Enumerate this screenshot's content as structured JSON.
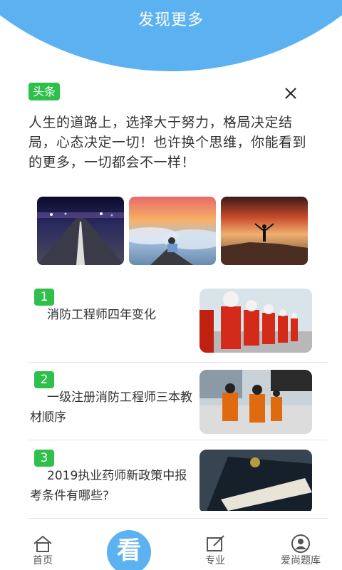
{
  "header": {
    "title": "发现更多"
  },
  "headline_card": {
    "tag": "头条",
    "text": "人生的道路上，选择大于努力，格局决定结局，心态决定一切！也许换个思维，你能看到的更多，一切都会不一样！",
    "images": [
      "night-road-photo",
      "sea-of-clouds-photo",
      "mountain-sunset-photo"
    ]
  },
  "articles": [
    {
      "num": "1",
      "title": "消防工程师四年变化",
      "image": "firefighters-parade-photo"
    },
    {
      "num": "2",
      "title": "一级注册消防工程师三本教材顺序",
      "image": "firefighters-training-photo"
    },
    {
      "num": "3",
      "title": "2019执业药师新政策中报考条件有哪些?",
      "image": "pharmacist-certificate-photo"
    }
  ],
  "bottom_nav": {
    "home": "首页",
    "center": "看",
    "major": "专业",
    "question_bank": "爱尚题库"
  },
  "colors": {
    "accent": "#5cb2f0",
    "tag_green": "#2ec04a"
  }
}
